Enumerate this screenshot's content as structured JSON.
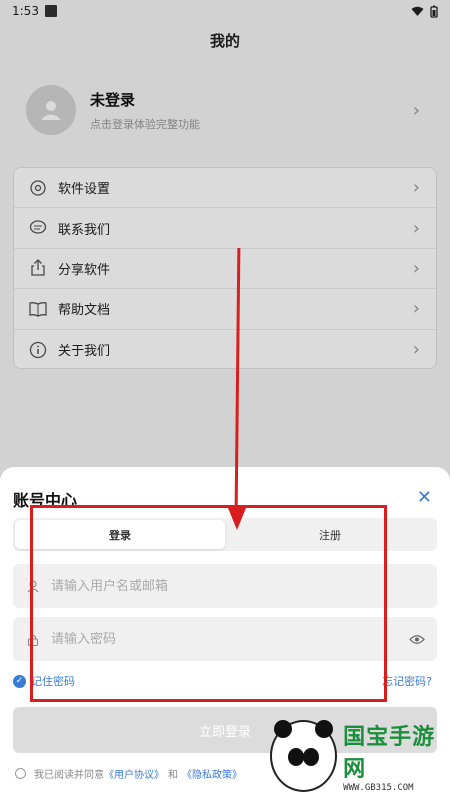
{
  "status_bar": {
    "time": "1:53"
  },
  "page": {
    "title": "我的"
  },
  "profile": {
    "name": "未登录",
    "subtitle": "点击登录体验完整功能"
  },
  "menu": [
    {
      "label": "软件设置",
      "icon": "gear-icon"
    },
    {
      "label": "联系我们",
      "icon": "chat-icon"
    },
    {
      "label": "分享软件",
      "icon": "share-icon"
    },
    {
      "label": "帮助文档",
      "icon": "book-icon"
    },
    {
      "label": "关于我们",
      "icon": "info-icon"
    }
  ],
  "sheet": {
    "title": "账号中心",
    "tabs": {
      "login": "登录",
      "register": "注册"
    },
    "username_placeholder": "请输入用户名或邮箱",
    "password_placeholder": "请输入密码",
    "remember": "记住密码",
    "forgot": "忘记密码?",
    "login_button": "立即登录",
    "agreement": {
      "prefix": "我已阅读并同意",
      "terms": "《用户协议》",
      "and": "和",
      "privacy": "《隐私政策》"
    }
  },
  "watermark": {
    "main": "国宝手游网",
    "sub": "WWW.GB315.COM"
  },
  "colors": {
    "accent": "#3a7bd5",
    "annotation": "#d91e1e",
    "watermark": "#1c8f3c"
  }
}
